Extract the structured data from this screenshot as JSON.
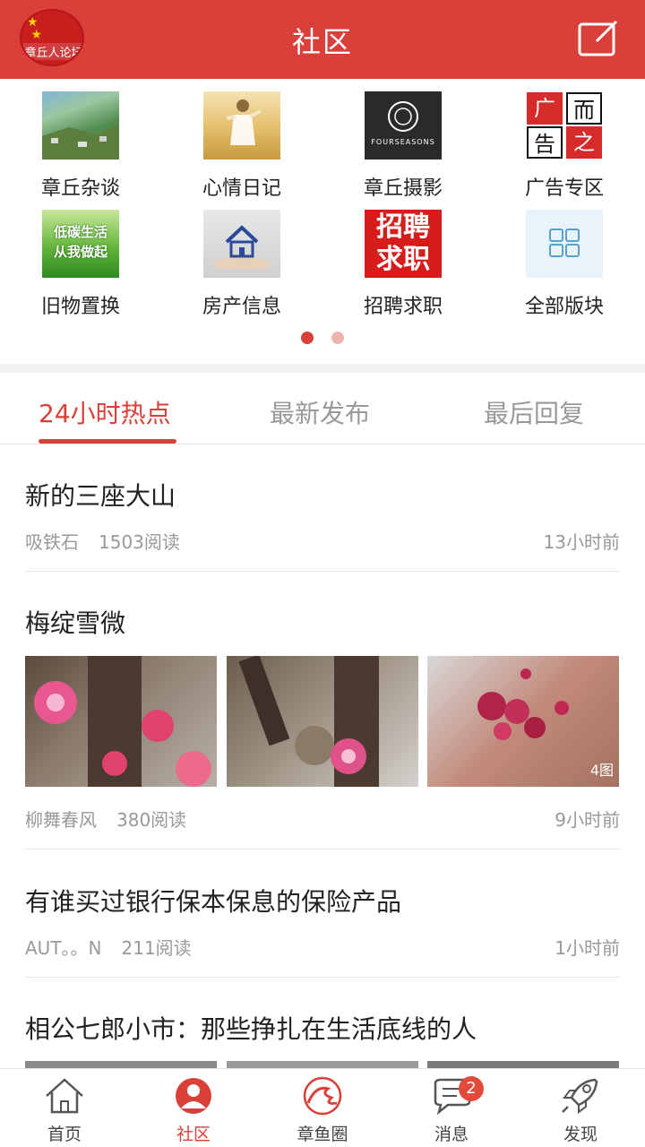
{
  "header": {
    "title": "社区",
    "logo_text": "章丘人论坛",
    "accent": "#d9403a"
  },
  "forums": [
    {
      "label": "章丘杂谈",
      "icon": "aerial-town-photo"
    },
    {
      "label": "心情日记",
      "icon": "wheat-field-photo"
    },
    {
      "label": "章丘摄影",
      "icon": "photography-logo",
      "thumb_text": "FOURSEASONS"
    },
    {
      "label": "广告专区",
      "icon": "ad-logo",
      "thumb_text": [
        "广",
        "而",
        "告",
        "之"
      ]
    },
    {
      "label": "旧物置换",
      "icon": "low-carbon-banner",
      "thumb_text": [
        "低碳生活",
        "从我做起"
      ]
    },
    {
      "label": "房产信息",
      "icon": "house-in-hand-photo"
    },
    {
      "label": "招聘求职",
      "icon": "recruit-banner",
      "thumb_text": [
        "招聘",
        "求职"
      ]
    },
    {
      "label": "全部版块",
      "icon": "grid-icon"
    }
  ],
  "pager": {
    "active_index": 0,
    "count": 2
  },
  "tabs": [
    {
      "label": "24小时热点",
      "active": true
    },
    {
      "label": "最新发布",
      "active": false
    },
    {
      "label": "最后回复",
      "active": false
    }
  ],
  "posts": [
    {
      "title": "新的三座大山",
      "author": "吸铁石",
      "reads": "1503阅读",
      "time": "13小时前"
    },
    {
      "title": "梅绽雪微",
      "author": "柳舞春风",
      "reads": "380阅读",
      "time": "9小时前",
      "photo_count": "4图"
    },
    {
      "title": "有谁买过银行保本保息的保险产品",
      "author": "AUT。。N",
      "reads": "211阅读",
      "time": "1小时前"
    },
    {
      "title": "相公七郎小市：那些挣扎在生活底线的人"
    }
  ],
  "bottom_nav": [
    {
      "label": "首页",
      "icon": "home-icon",
      "active": false
    },
    {
      "label": "社区",
      "icon": "community-icon",
      "active": true
    },
    {
      "label": "章鱼圈",
      "icon": "octopus-icon",
      "active": false
    },
    {
      "label": "消息",
      "icon": "message-icon",
      "active": false,
      "badge": "2"
    },
    {
      "label": "发现",
      "icon": "rocket-icon",
      "active": false
    }
  ]
}
